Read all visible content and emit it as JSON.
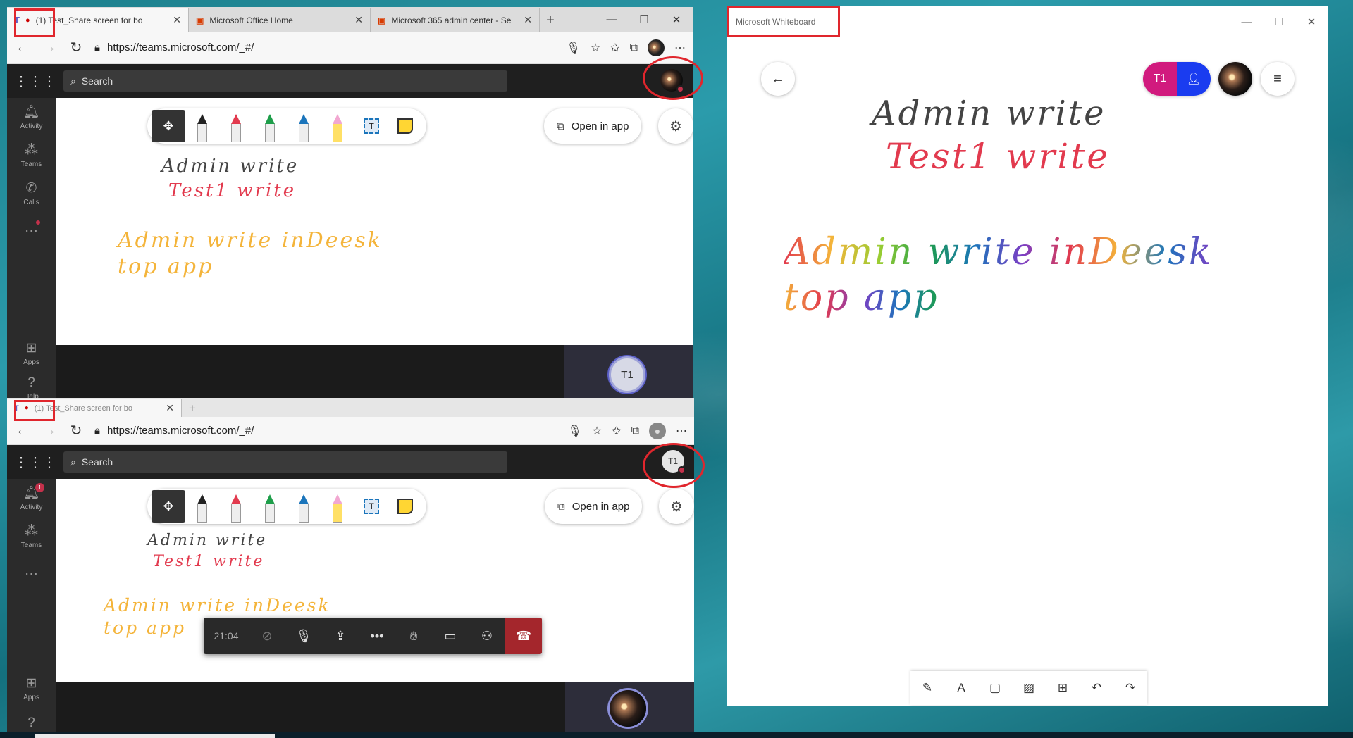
{
  "top_browser": {
    "tabs": [
      {
        "title": "(1) Test_Share screen for bo",
        "active": true
      },
      {
        "title": "Microsoft Office Home",
        "active": false
      },
      {
        "title": "Microsoft 365 admin center - Se",
        "active": false
      }
    ],
    "url": "https://teams.microsoft.com/_#/",
    "search_placeholder": "Search",
    "rail": [
      {
        "label": "Activity"
      },
      {
        "label": "Teams"
      },
      {
        "label": "Calls"
      },
      {
        "label": ""
      }
    ],
    "rail_bottom": [
      {
        "label": "Apps"
      },
      {
        "label": "Help"
      }
    ],
    "open_in_app": "Open in app",
    "tile_initials": "T1"
  },
  "bottom_browser": {
    "tab_title": "(1) Test_Share screen for bo",
    "url": "https://teams.microsoft.com/_#/",
    "search_placeholder": "Search",
    "avatar_initials": "T1",
    "activity_badge": "1",
    "rail": [
      {
        "label": "Activity"
      },
      {
        "label": "Teams"
      }
    ],
    "rail_bottom": [
      {
        "label": "Apps"
      }
    ],
    "open_in_app": "Open in app",
    "call_timer": "21:04"
  },
  "ink": {
    "line1": "Admin write",
    "line2": "Test1 write",
    "line3": "Admin write inDeesk",
    "line4": "top app"
  },
  "whiteboard_app": {
    "title": "Microsoft Whiteboard",
    "participant_initials": "T1"
  },
  "colors": {
    "teams_dark": "#1f1f1f",
    "ink_red": "#e23a4e",
    "ink_orange": "#f4b43a",
    "hangup": "#a4262c",
    "highlight": "#e0262d"
  }
}
